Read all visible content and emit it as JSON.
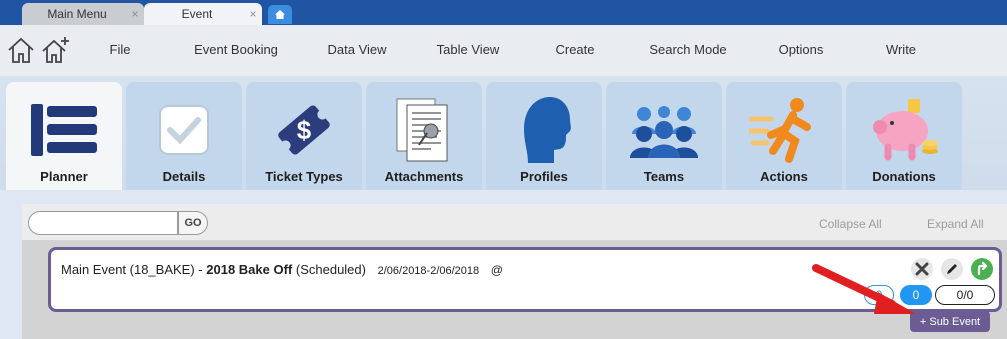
{
  "tabs": [
    {
      "label": "Main Menu",
      "close": "×"
    },
    {
      "label": "Event",
      "close": "×"
    }
  ],
  "new_tab_icon": "home-icon",
  "menu": {
    "home_icons": [
      "home-icon",
      "home-add-icon"
    ],
    "items": [
      "File",
      "Event Booking",
      "Data View",
      "Table View",
      "Create",
      "Search Mode",
      "Options",
      "Write"
    ]
  },
  "modules": [
    {
      "label": "Planner",
      "icon": "planner-icon",
      "active": true
    },
    {
      "label": "Details",
      "icon": "checkbox-icon"
    },
    {
      "label": "Ticket Types",
      "icon": "ticket-dollar-icon"
    },
    {
      "label": "Attachments",
      "icon": "documents-paperclip-icon"
    },
    {
      "label": "Profiles",
      "icon": "head-profile-icon"
    },
    {
      "label": "Teams",
      "icon": "people-group-icon"
    },
    {
      "label": "Actions",
      "icon": "running-man-icon"
    },
    {
      "label": "Donations",
      "icon": "piggy-bank-icon"
    }
  ],
  "planner": {
    "search": {
      "value": "",
      "placeholder": ""
    },
    "go_label": "GO",
    "collapse_all": "Collapse All",
    "expand_all": "Expand All",
    "event": {
      "prefix": "Main Event (18_BAKE) -",
      "name": "2018 Bake Off",
      "status": "(Scheduled)",
      "dates": "2/06/2018-2/06/2018",
      "location": "@",
      "counts": [
        "0",
        "0",
        "0/0"
      ]
    },
    "sub_event_label": "+ Sub Event"
  },
  "colors": {
    "tab_strip": "#1f55a3",
    "event_border": "#6c5c94",
    "accent_blue": "#2196f3",
    "arrow_red": "#e02020"
  }
}
